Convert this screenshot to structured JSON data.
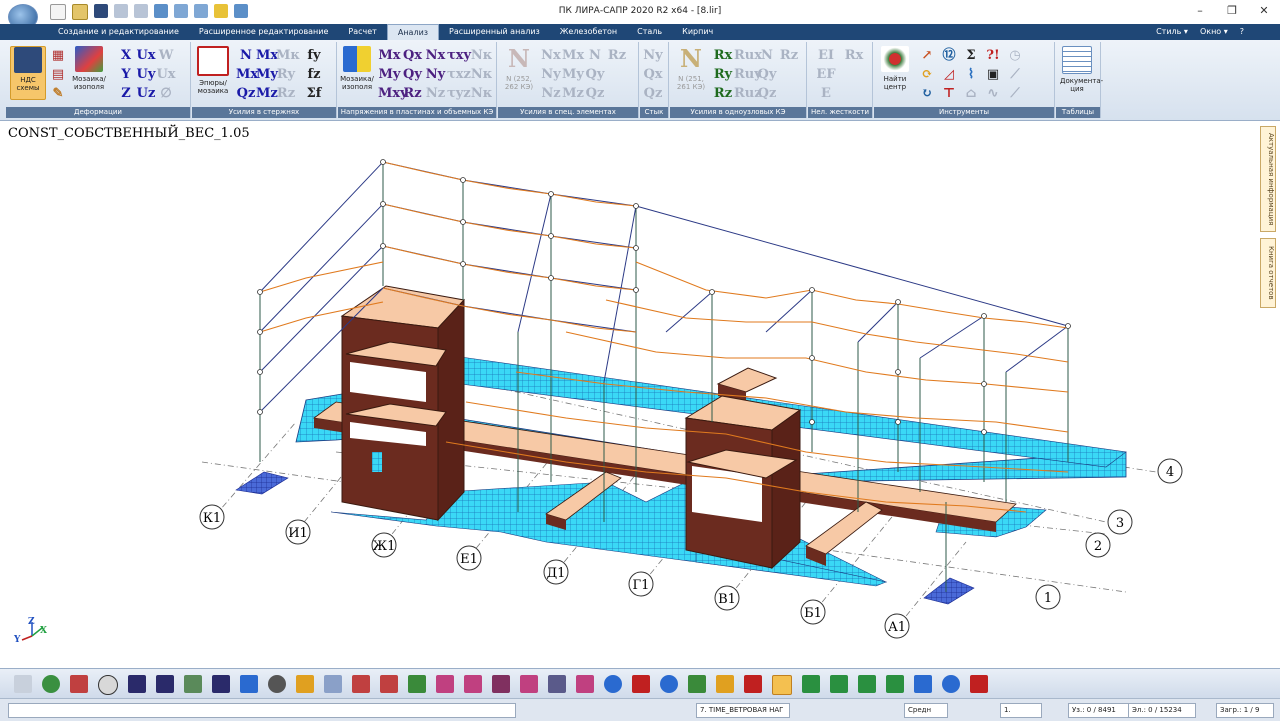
{
  "window": {
    "title": "ПК ЛИРА-САПР  2020 R2 x64 - [8.lir]",
    "controls": [
      "–",
      "❐",
      "✕"
    ]
  },
  "menu_right": [
    "Стиль ▾",
    "Окно ▾",
    "?"
  ],
  "tabs": [
    {
      "label": "Создание и редактирование"
    },
    {
      "label": "Расширенное редактирование"
    },
    {
      "label": "Расчет"
    },
    {
      "label": "Анализ",
      "active": true
    },
    {
      "label": "Расширенный анализ"
    },
    {
      "label": "Железобетон"
    },
    {
      "label": "Сталь"
    },
    {
      "label": "Кирпич"
    }
  ],
  "ribbon": {
    "groups": [
      {
        "label": "Деформации",
        "big_button": "НДС схемы",
        "big_button2": "Мозаика/ изополя"
      },
      {
        "label": "Усилия в стержнях",
        "big_button": "Эпюры/ мозаика"
      },
      {
        "label": "Напряжения в пластинах и объемных КЭ",
        "big_button": "Мозаика/ изополя"
      },
      {
        "label": "Усилия в спец. элементах",
        "big_button": "N (252, 262 КЭ)"
      },
      {
        "label": "Стык"
      },
      {
        "label": "Усилия в одноузловых КЭ",
        "big_button": "N (251, 261 КЭ)"
      },
      {
        "label": "Нел. жесткости"
      },
      {
        "label": "Инструменты",
        "big_button": "Найти центр"
      },
      {
        "label": "Таблицы",
        "big_button": "Документа- ция"
      }
    ],
    "deform_icons": [
      "X",
      "Ux",
      "W",
      "Y",
      "Uy",
      "Ux",
      "Z",
      "Uz",
      "∅"
    ],
    "rod_icons": [
      "N",
      "Mx",
      "Mк",
      "Mx",
      "My",
      "Ry",
      "Qz",
      "Mz",
      "Rz"
    ],
    "plate_icons": [
      "Mx",
      "Qx",
      "Nx",
      "τxy",
      "Nк",
      "My",
      "Qy",
      "Ny",
      "τxz",
      "Nк",
      "Mxy",
      "Rz",
      "Nz",
      "τyz",
      "Nк"
    ],
    "fy": [
      "fy",
      "fz",
      "Σf"
    ]
  },
  "side_tabs": [
    "Актуальная информация",
    "Книга отчетов"
  ],
  "viewport": {
    "case_label": "CONST_СОБСТВЕННЫЙ_ВЕС_1.05",
    "axes_letters": [
      "К1",
      "И1",
      "Ж1",
      "Е1",
      "Д1",
      "Г1",
      "В1",
      "Б1",
      "А1"
    ],
    "axes_numbers": [
      "1",
      "2",
      "3",
      "4"
    ],
    "triad": {
      "x": "X",
      "y": "Y",
      "z": "Z"
    }
  },
  "status": {
    "time_case": "7. TIME_ВЕТРОВАЯ НАГ",
    "scale": "Средн",
    "step": "1.",
    "nodes": "Уз.: 0 / 8491",
    "elements": "Эл.: 0 / 15234",
    "load": "Загр.: 1 / 9"
  },
  "colors": {
    "accent": "#1f4776",
    "frame": "#2c3a86",
    "deform": "#e07a1e",
    "slab": "#2ad0f0",
    "wall": "#6b2b1f"
  }
}
